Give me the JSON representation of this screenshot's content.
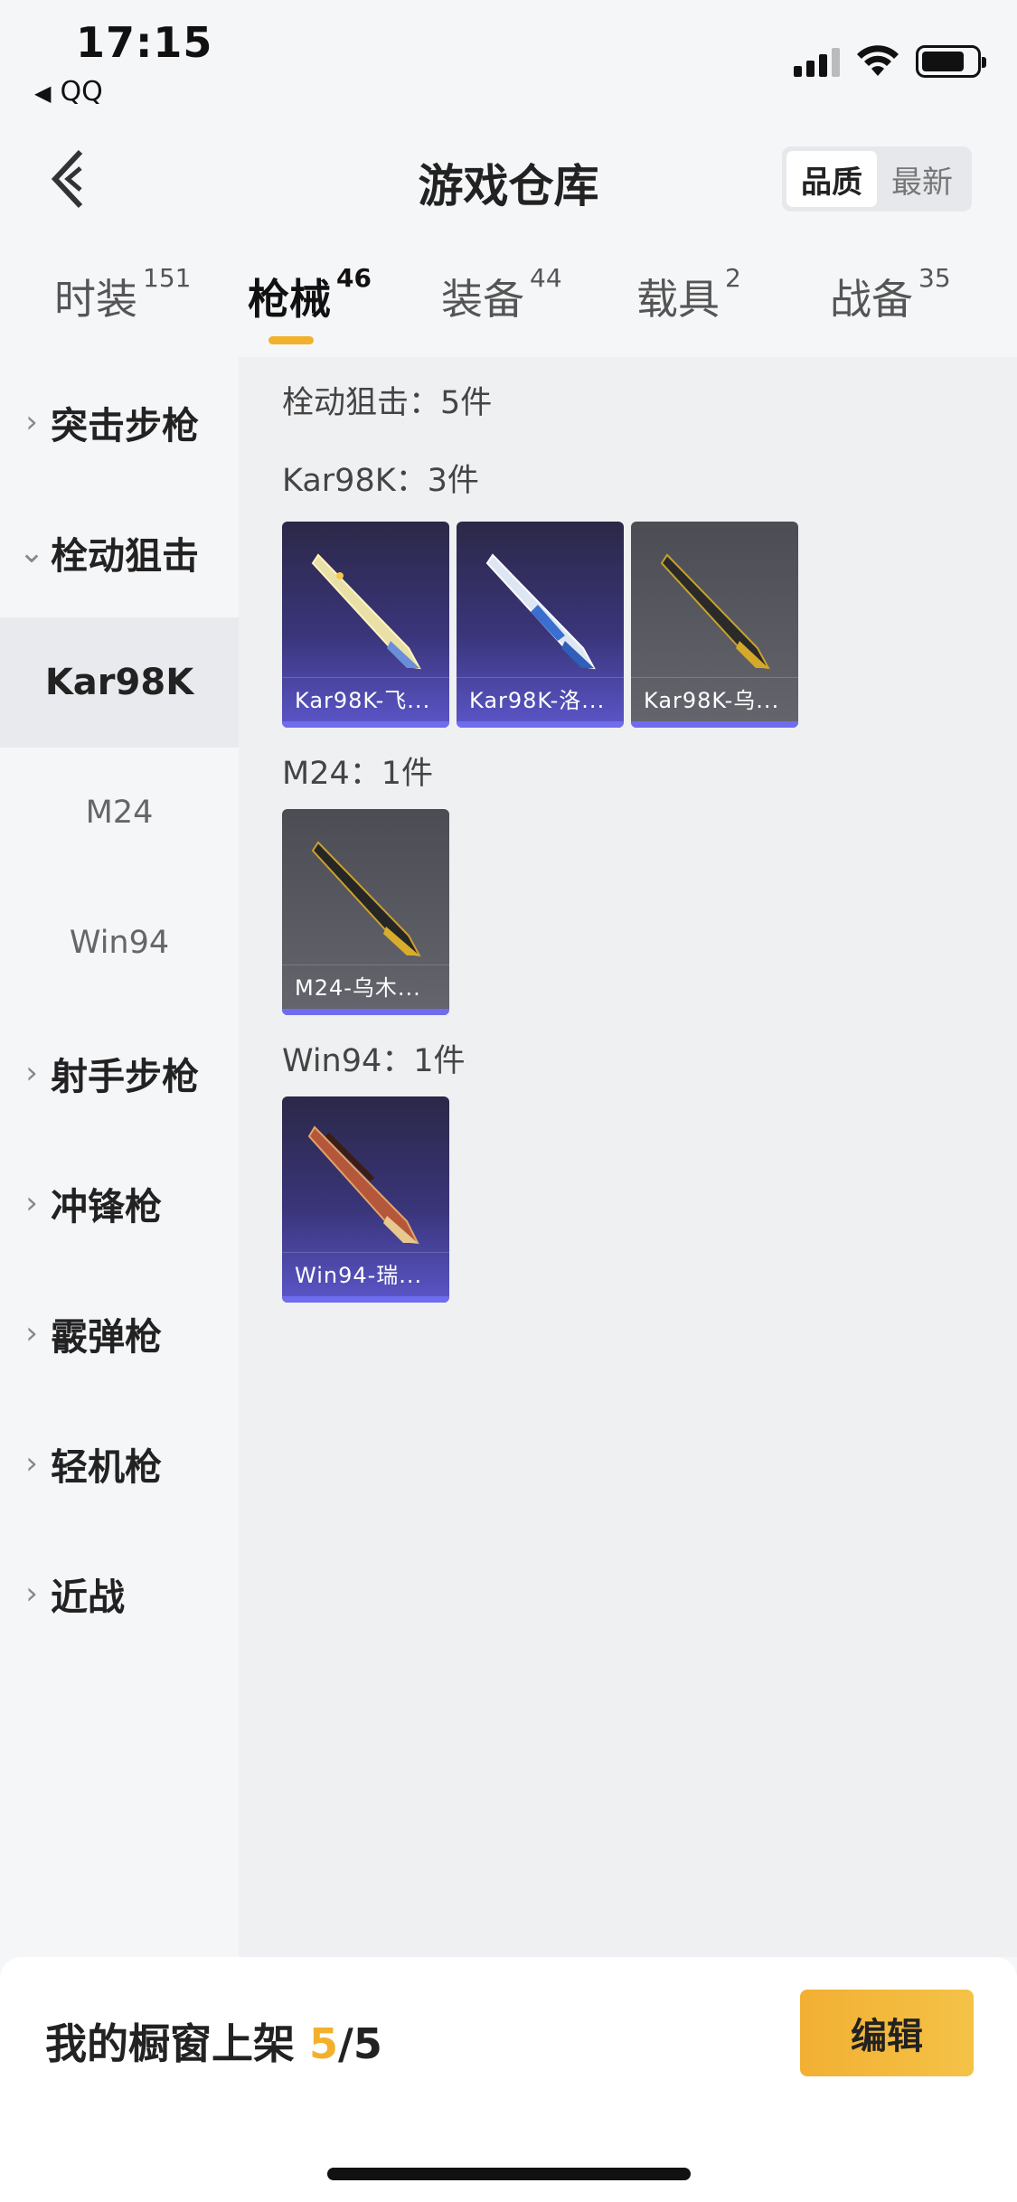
{
  "status": {
    "time": "17:15",
    "back_app": "QQ"
  },
  "header": {
    "title": "游戏仓库",
    "sort_options": [
      "品质",
      "最新"
    ],
    "active_sort": "品质"
  },
  "tabs": [
    {
      "label": "时装",
      "count": "151"
    },
    {
      "label": "枪械",
      "count": "46"
    },
    {
      "label": "装备",
      "count": "44"
    },
    {
      "label": "载具",
      "count": "2"
    },
    {
      "label": "战备",
      "count": "35"
    }
  ],
  "sidebar": {
    "categories": [
      "突击步枪",
      "栓动狙击",
      "射手步枪",
      "冲锋枪",
      "霰弹枪",
      "轻机枪",
      "近战"
    ],
    "subitems": [
      "Kar98K",
      "M24",
      "Win94"
    ]
  },
  "content": {
    "section_title": "栓动狙击：5件",
    "groups": [
      {
        "title": "Kar98K：3件",
        "items": [
          "Kar98K-飞...",
          "Kar98K-洛...",
          "Kar98K-乌..."
        ]
      },
      {
        "title": "M24：1件",
        "items": [
          "M24-乌木..."
        ]
      },
      {
        "title": "Win94：1件",
        "items": [
          "Win94-瑞..."
        ]
      }
    ]
  },
  "bottom": {
    "label": "我的橱窗上架 ",
    "count": "5",
    "total": "/5",
    "edit_label": "编辑"
  },
  "colors": {
    "accent": "#f3b02b",
    "rarity_purple": "#6f6cf0"
  }
}
